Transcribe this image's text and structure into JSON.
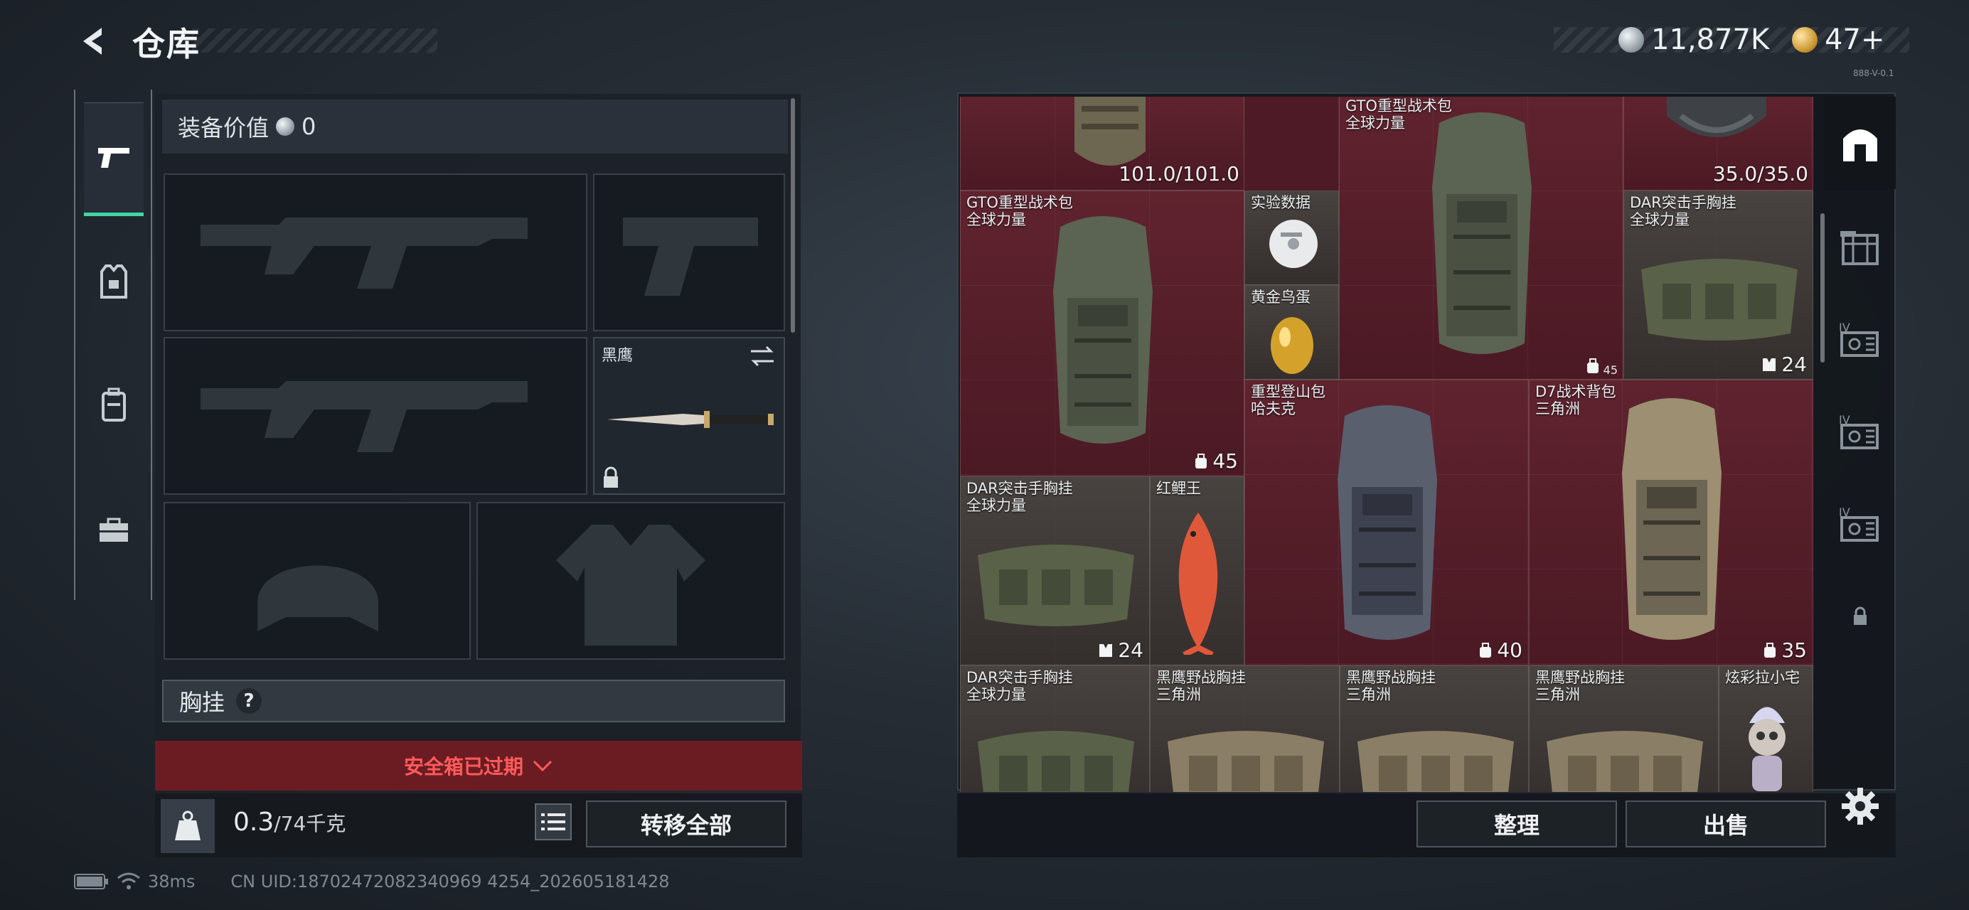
{
  "header": {
    "title": "仓库",
    "currency": {
      "silver": "11,877K",
      "gold": "47+"
    },
    "version": "888-V-0.1"
  },
  "left_tabs": [
    "weapon",
    "armor",
    "backpack",
    "supply"
  ],
  "loadout": {
    "value_label": "装备价值",
    "value": "0",
    "melee_name": "黑鹰",
    "chest_rig_label": "胸挂",
    "help_glyph": "?",
    "safebox_expired": "安全箱已过期",
    "weight_current": "0.3",
    "weight_max": "/74千克",
    "transfer_all": "转移全部"
  },
  "status_bar": {
    "ping": "38ms",
    "uid": "CN UID:18702472082340969 4254_202605181428"
  },
  "stash": {
    "items": [
      {
        "id": "top-left",
        "name": "",
        "sub": "",
        "durability": "101.0/101.0"
      },
      {
        "id": "gto-top",
        "name": "GTO重型战术包",
        "sub": "全球力量"
      },
      {
        "id": "helmet-top",
        "name": "",
        "sub": "",
        "durability": "35.0/35.0"
      },
      {
        "id": "gto-left",
        "name": "GTO重型战术包",
        "sub": "全球力量",
        "count": "45"
      },
      {
        "id": "data",
        "name": "实验数据",
        "sub": ""
      },
      {
        "id": "egg",
        "name": "黄金鸟蛋",
        "sub": ""
      },
      {
        "id": "gto-mid",
        "name": "",
        "sub": "",
        "count": "45"
      },
      {
        "id": "dar-top-right",
        "name": "DAR突击手胸挂",
        "sub": "全球力量",
        "count": "24"
      },
      {
        "id": "mountain-pack",
        "name": "重型登山包",
        "sub": "哈夫克",
        "count": "40"
      },
      {
        "id": "d7-pack",
        "name": "D7战术背包",
        "sub": "三角洲",
        "count": "35"
      },
      {
        "id": "dar-mid-left",
        "name": "DAR突击手胸挂",
        "sub": "全球力量",
        "count": "24"
      },
      {
        "id": "fish",
        "name": "红鲤王",
        "sub": ""
      },
      {
        "id": "dar-bottom",
        "name": "DAR突击手胸挂",
        "sub": "全球力量"
      },
      {
        "id": "hawk-rig-1",
        "name": "黑鹰野战胸挂",
        "sub": "三角洲"
      },
      {
        "id": "hawk-rig-2",
        "name": "黑鹰野战胸挂",
        "sub": "三角洲"
      },
      {
        "id": "hawk-rig-3",
        "name": "黑鹰野战胸挂",
        "sub": "三角洲"
      },
      {
        "id": "figurine",
        "name": "炫彩拉小宅",
        "sub": ""
      }
    ],
    "organize": "整理",
    "sell": "出售"
  },
  "colors": {
    "accent_active": "#41d6a4",
    "grid_background": "#4e1a25",
    "alert_red": "#ff5a5a"
  }
}
